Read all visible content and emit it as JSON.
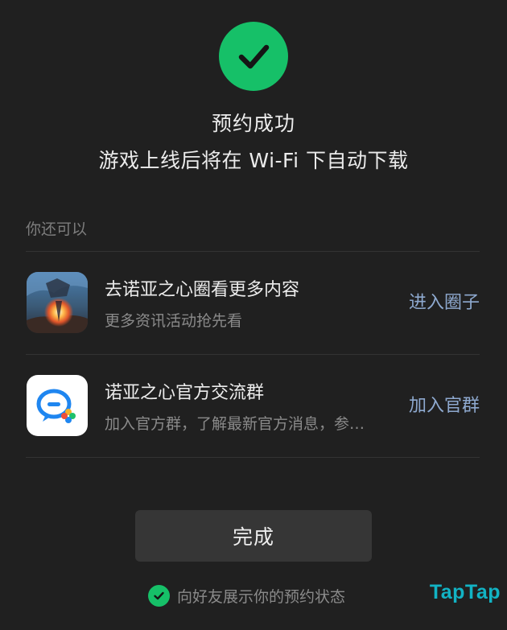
{
  "header": {
    "status_icon": "checkmark-icon",
    "title": "预约成功",
    "subtitle": "游戏上线后将在 Wi-Fi 下自动下载"
  },
  "section": {
    "label": "你还可以"
  },
  "items": [
    {
      "icon": "game-artwork-icon",
      "title": "去诺亚之心圈看更多内容",
      "desc": "更多资讯活动抢先看",
      "action": "进入圈子"
    },
    {
      "icon": "chat-bubbles-icon",
      "title": "诺亚之心官方交流群",
      "desc": "加入官方群，了解最新官方消息，参…",
      "action": "加入官群"
    }
  ],
  "footer": {
    "done_label": "完成",
    "share_label": "向好友展示你的预约状态",
    "share_checked": true
  },
  "watermark": "TapTap",
  "colors": {
    "background": "#202020",
    "success_green": "#16c068",
    "action_blue": "#8ea9cf",
    "watermark_teal": "#12b3c4"
  }
}
